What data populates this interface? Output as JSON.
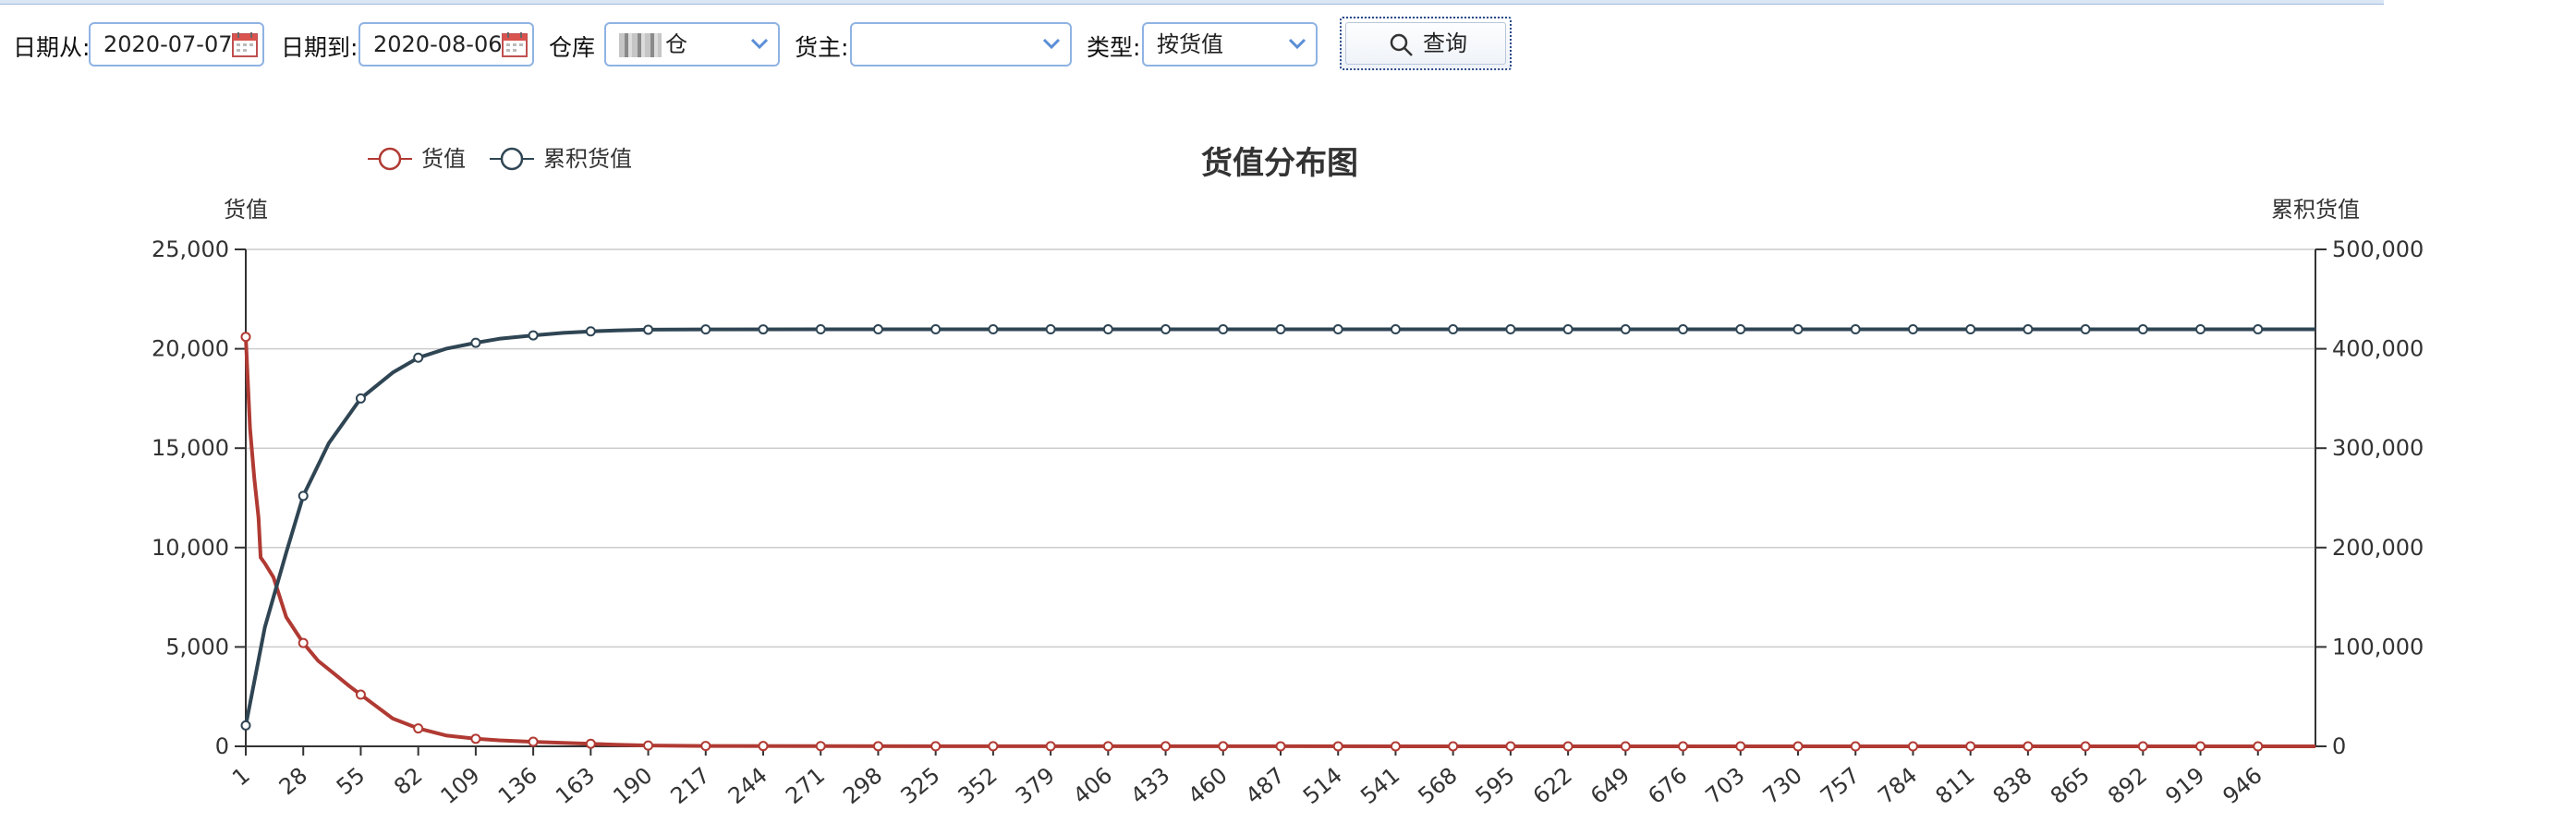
{
  "toolbar": {
    "date_from_label": "日期从:",
    "date_from_value": "2020-07-07",
    "date_to_label": "日期到:",
    "date_to_value": "2020-08-06",
    "warehouse_label": "仓库",
    "warehouse_value": "仓",
    "owner_label": "货主:",
    "owner_value": "",
    "type_label": "类型:",
    "type_value": "按货值",
    "query_button": "查询"
  },
  "colors": {
    "value_series": "#b03a33",
    "cumulative_series": "#2f4554",
    "field_border": "#8fb3e3",
    "grid": "#cccccc"
  },
  "chart_data": {
    "type": "line",
    "title": "货值分布图",
    "y_left_label": "货值",
    "y_right_label": "累积货值",
    "legend_position": "top-left",
    "grid": true,
    "y_left_ticks": [
      "0",
      "5,000",
      "10,000",
      "15,000",
      "20,000",
      "25,000"
    ],
    "y_right_ticks": [
      "0",
      "100,000",
      "200,000",
      "300,000",
      "400,000",
      "500,000"
    ],
    "x_ticks": [
      "1",
      "28",
      "55",
      "82",
      "109",
      "136",
      "163",
      "190",
      "217",
      "244",
      "271",
      "298",
      "325",
      "352",
      "379",
      "406",
      "433",
      "460",
      "487",
      "514",
      "541",
      "568",
      "595",
      "622",
      "649",
      "676",
      "703",
      "730",
      "757",
      "784",
      "811",
      "838",
      "865",
      "892",
      "919",
      "946"
    ],
    "x_range": [
      1,
      973
    ],
    "y_left_range": [
      0,
      25000
    ],
    "y_right_range": [
      0,
      500000
    ],
    "series": [
      {
        "name": "货值",
        "axis": "left",
        "color": "#b03a33",
        "x": [
          1,
          3,
          5,
          7,
          8,
          10,
          14,
          20,
          28,
          35,
          42,
          50,
          55,
          60,
          70,
          82,
          95,
          109,
          120,
          136,
          150,
          163,
          175,
          190,
          217,
          271,
          352,
          460,
          568,
          676,
          784,
          892,
          973
        ],
        "values": [
          20600,
          16000,
          13500,
          11500,
          9500,
          9200,
          8500,
          6500,
          5200,
          4300,
          3700,
          3000,
          2600,
          2200,
          1400,
          900,
          550,
          380,
          300,
          230,
          170,
          130,
          80,
          40,
          20,
          10,
          6,
          3,
          2,
          1,
          1,
          0,
          0
        ]
      },
      {
        "name": "累积货值",
        "axis": "right",
        "color": "#2f4554",
        "x": [
          1,
          10,
          20,
          28,
          40,
          55,
          70,
          82,
          95,
          109,
          120,
          136,
          150,
          163,
          175,
          190,
          217,
          271,
          352,
          460,
          568,
          676,
          784,
          892,
          973
        ],
        "values": [
          21000,
          120000,
          195000,
          252000,
          305000,
          350000,
          376000,
          391000,
          400000,
          406000,
          410000,
          413500,
          416000,
          417500,
          418500,
          419200,
          419500,
          419600,
          419600,
          419600,
          419600,
          419600,
          419600,
          419600,
          419600
        ]
      }
    ]
  }
}
